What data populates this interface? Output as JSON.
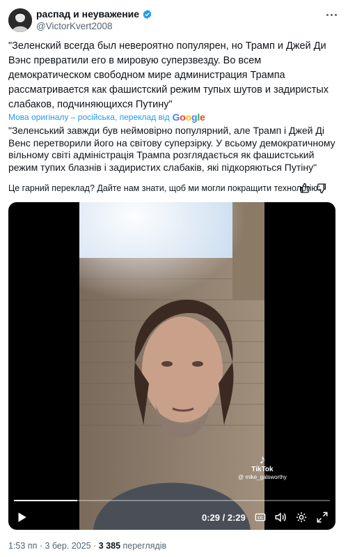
{
  "author": {
    "name": "распад и неуважение",
    "handle": "@VictorKvert2008"
  },
  "tweet": {
    "original_text": "\"Зеленский всегда был невероятно популярен, но Трамп и Джей Ди Вэнс превратили его в мировую суперзвезду. Во всем демократическом свободном мире администрация Трампа рассматривается как фашистский режим тупых шутов и задиристых слабаков, подчиняющихся Путину\"",
    "translation_note": "Мова оригіналу – російська, переклад від",
    "translation_provider": "Google",
    "translated_text": "\"Зеленський завжди був неймовірно популярний, але Трамп і Джей Ді Венс перетворили його на світову суперзірку. У всьому демократичному вільному світі адміністрація Трампа розглядається як фашистський режим тупих блазнів і задиристих слабаків, які підкоряються Путіну\"",
    "feedback_prompt": "Це гарний переклад? Дайте нам знати, щоб ми могли покращити технологію:"
  },
  "video": {
    "current_time": "0:29",
    "duration": "2:29",
    "time_display": "0:29 / 2:29",
    "progress_fraction": 0.2,
    "watermark_brand": "TikTok",
    "watermark_user": "@ mike_galsworthy"
  },
  "meta": {
    "time": "1:53 пп",
    "separator": "·",
    "date": "3 бер. 2025",
    "views_count": "3 385",
    "views_label": "переглядів"
  },
  "icons": {
    "more": "more-icon",
    "verified": "verified-badge-icon",
    "thumbs_up": "thumbs-up-icon",
    "thumbs_down": "thumbs-down-icon",
    "play": "play-icon",
    "captions": "captions-icon",
    "volume": "volume-icon",
    "settings": "settings-icon",
    "fullscreen": "fullscreen-icon"
  },
  "colors": {
    "accent": "#1d9bf0",
    "text": "#0f1419",
    "secondary": "#536471"
  }
}
